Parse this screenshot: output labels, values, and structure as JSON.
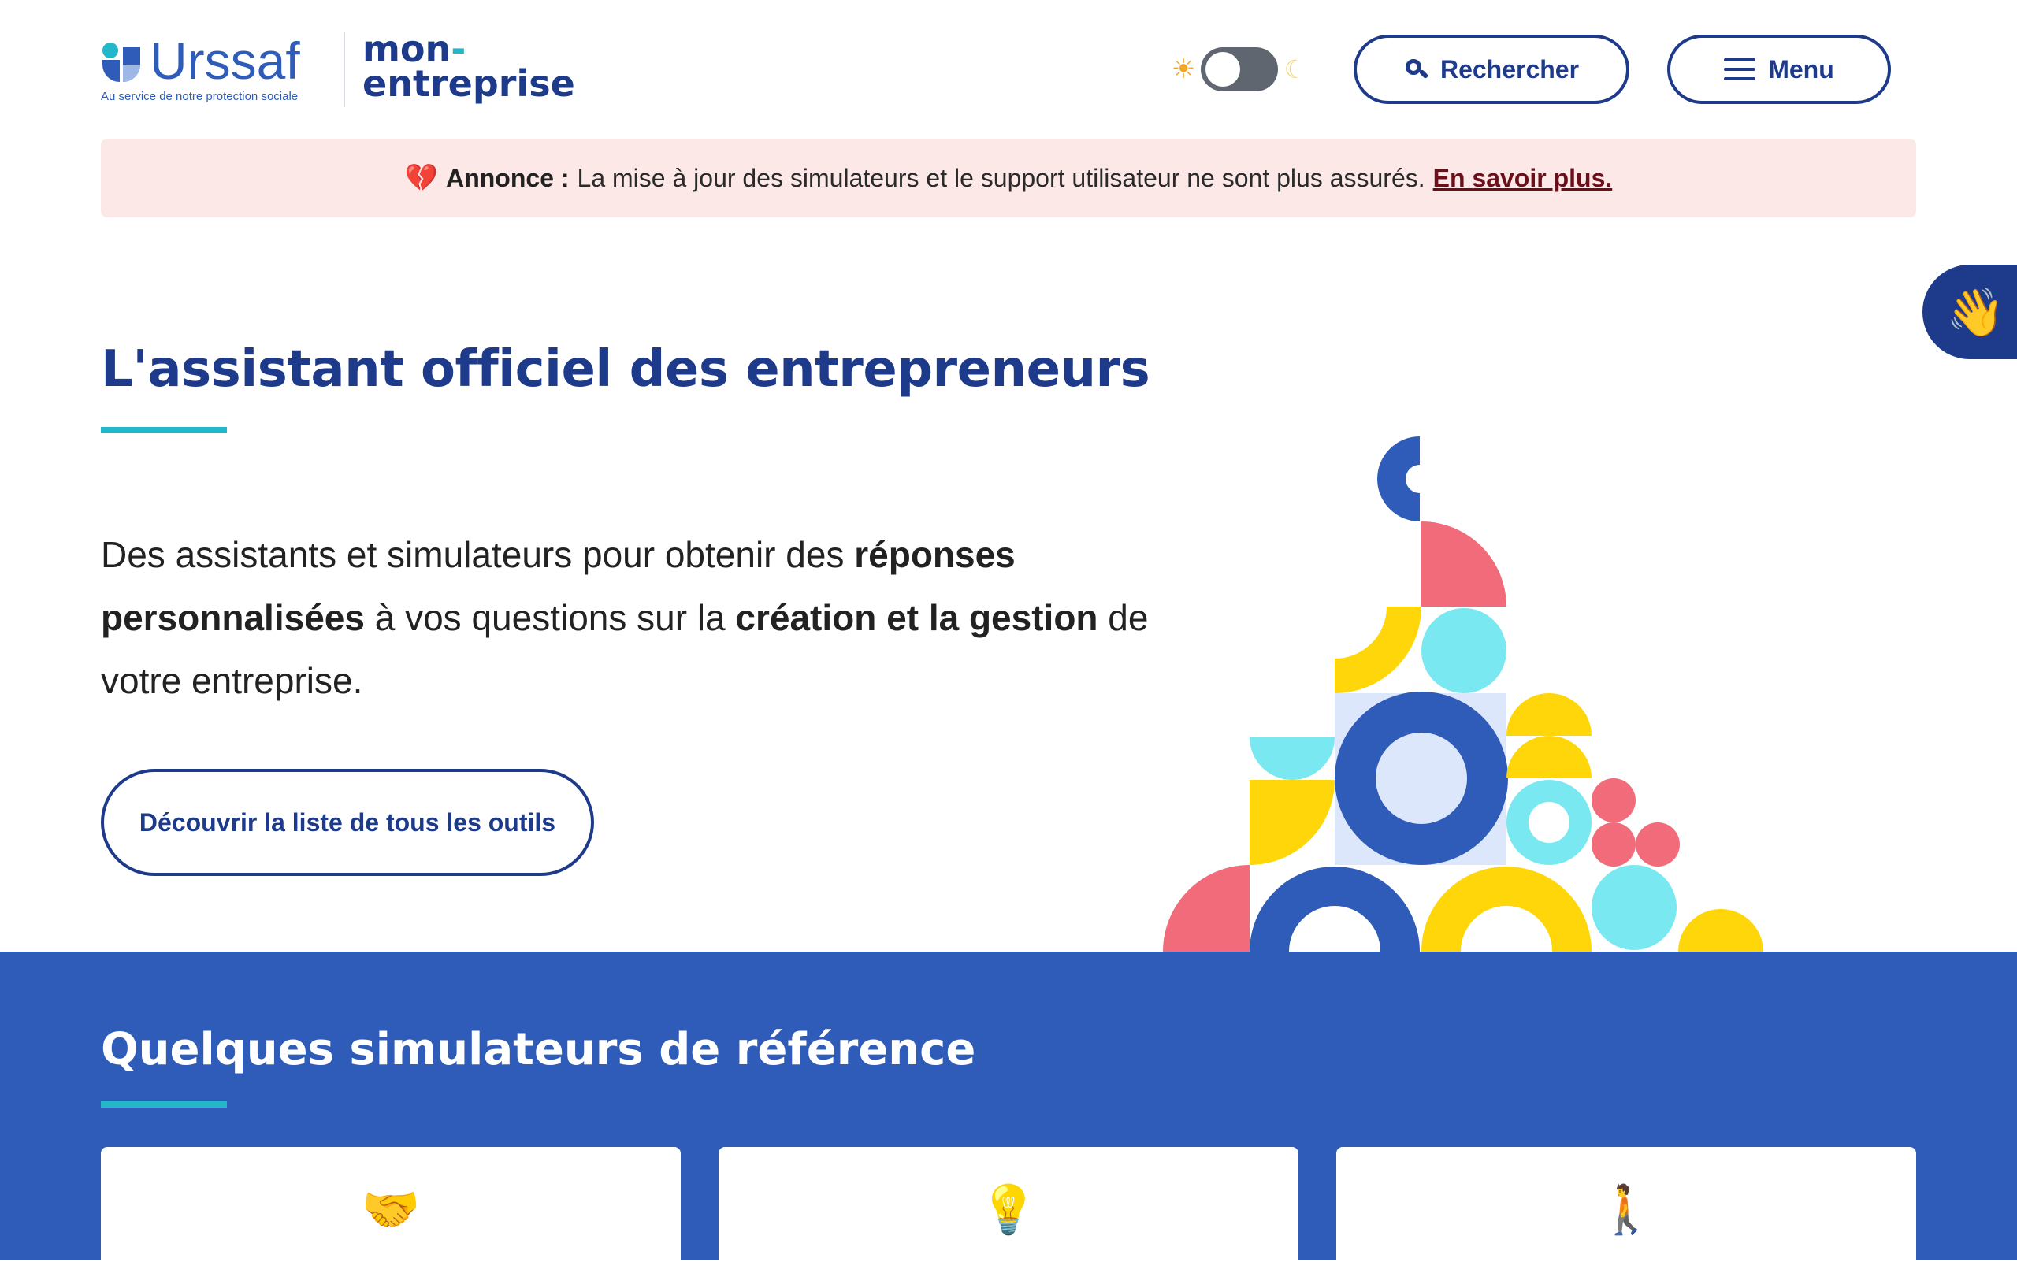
{
  "header": {
    "brand_name": "Urssaf",
    "brand_tagline": "Au service de notre protection sociale",
    "product_line1": "mon",
    "product_dash": "-",
    "product_line2": "entreprise",
    "search_label": "Rechercher",
    "menu_label": "Menu",
    "theme_toggle": {
      "state": "light"
    }
  },
  "banner": {
    "label": "Annonce :",
    "text": "La mise à jour des simulateurs et le support utilisateur ne sont plus assurés.",
    "link": "En savoir plus."
  },
  "hero": {
    "title": "L'assistant officiel des entrepreneurs",
    "text_part1": "Des assistants et simulateurs pour obtenir des ",
    "text_bold1": "réponses personnalisées",
    "text_part2": " à vos questions sur la ",
    "text_bold2": "création et la gestion",
    "text_part3": " de votre entreprise.",
    "cta": "Découvrir la liste de tous les outils"
  },
  "simulators": {
    "title": "Quelques simulateurs de référence",
    "cards": [
      {
        "emoji": "🤝"
      },
      {
        "emoji": "💡"
      },
      {
        "emoji": "🚶"
      }
    ]
  },
  "colors": {
    "primary": "#1e3a8a",
    "section_blue": "#2e5cb8",
    "accent_teal": "#22b8c9",
    "banner_bg": "#fde8e8",
    "shape_pink": "#f26b7a",
    "shape_yellow": "#ffd60a",
    "shape_cyan": "#7ae8f0",
    "shape_blue": "#2e5cb8"
  }
}
